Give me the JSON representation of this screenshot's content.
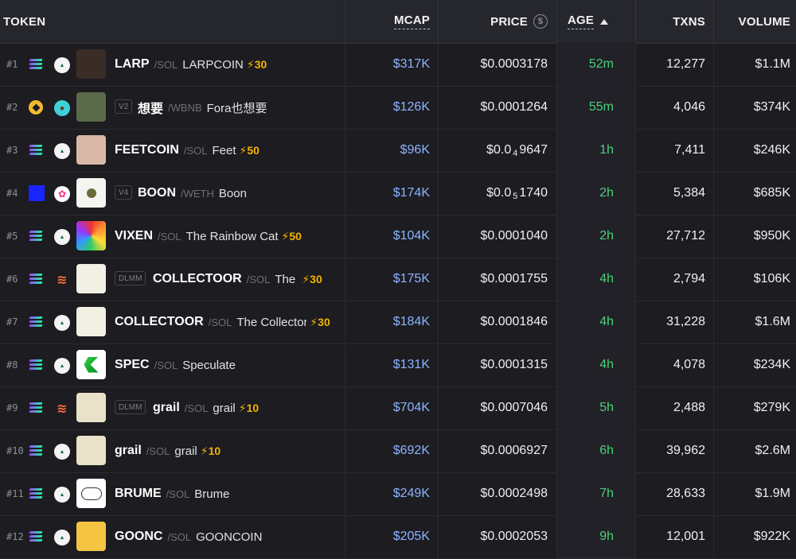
{
  "header": {
    "token": "TOKEN",
    "mcap": "MCAP",
    "price": "PRICE",
    "age": "AGE",
    "txns": "TXNS",
    "volume": "VOLUME"
  },
  "colors": {
    "mcap": "#8cb4ff",
    "age": "#4ad07a",
    "boost": "#f5b400"
  },
  "rows": [
    {
      "rank": "#1",
      "chain": "solana-icon",
      "dex": "raydium-swap-icon",
      "tag": "",
      "symbol": "LARP",
      "quote": "/SOL",
      "name": "LARPCOIN",
      "boost": "⚡30",
      "mcap": "$317K",
      "price_a": "$0.0003178",
      "price_sub": "",
      "price_b": "",
      "age": "52m",
      "txns": "12,277",
      "volume": "$1.1M"
    },
    {
      "rank": "#2",
      "chain": "bnb-icon",
      "dex": "pancakeswap-icon",
      "tag": "V2",
      "symbol": "想要",
      "quote": "/WBNB",
      "name": "Fora也想要",
      "boost": "",
      "mcap": "$126K",
      "price_a": "$0.0001264",
      "price_sub": "",
      "price_b": "",
      "age": "55m",
      "txns": "4,046",
      "volume": "$374K"
    },
    {
      "rank": "#3",
      "chain": "solana-icon",
      "dex": "raydium-swap-icon",
      "tag": "",
      "symbol": "FEETCOIN",
      "quote": "/SOL",
      "name": "Feet",
      "boost": "⚡50",
      "mcap": "$96K",
      "price_a": "$0.0",
      "price_sub": "4",
      "price_b": "9647",
      "age": "1h",
      "txns": "7,411",
      "volume": "$246K"
    },
    {
      "rank": "#4",
      "chain": "base-icon",
      "dex": "uniswap-icon",
      "tag": "V4",
      "symbol": "BOON",
      "quote": "/WETH",
      "name": "Boon",
      "boost": "",
      "mcap": "$174K",
      "price_a": "$0.0",
      "price_sub": "5",
      "price_b": "1740",
      "age": "2h",
      "txns": "5,384",
      "volume": "$685K"
    },
    {
      "rank": "#5",
      "chain": "solana-icon",
      "dex": "raydium-swap-icon",
      "tag": "",
      "symbol": "VIXEN",
      "quote": "/SOL",
      "name": "The Rainbow Cat",
      "boost": "⚡50",
      "mcap": "$104K",
      "price_a": "$0.0001040",
      "price_sub": "",
      "price_b": "",
      "age": "2h",
      "txns": "27,712",
      "volume": "$950K"
    },
    {
      "rank": "#6",
      "chain": "solana-icon",
      "dex": "meteora-icon",
      "tag": "DLMM",
      "symbol": "COLLECTOOR",
      "quote": "/SOL",
      "name": "The Collector",
      "boost": "⚡30",
      "mcap": "$175K",
      "price_a": "$0.0001755",
      "price_sub": "",
      "price_b": "",
      "age": "4h",
      "txns": "2,794",
      "volume": "$106K"
    },
    {
      "rank": "#7",
      "chain": "solana-icon",
      "dex": "raydium-swap-icon",
      "tag": "",
      "symbol": "COLLECTOOR",
      "quote": "/SOL",
      "name": "The Collector",
      "boost": "⚡30",
      "mcap": "$184K",
      "price_a": "$0.0001846",
      "price_sub": "",
      "price_b": "",
      "age": "4h",
      "txns": "31,228",
      "volume": "$1.6M"
    },
    {
      "rank": "#8",
      "chain": "solana-icon",
      "dex": "raydium-swap-icon",
      "tag": "",
      "symbol": "SPEC",
      "quote": "/SOL",
      "name": "Speculate",
      "boost": "",
      "mcap": "$131K",
      "price_a": "$0.0001315",
      "price_sub": "",
      "price_b": "",
      "age": "4h",
      "txns": "4,078",
      "volume": "$234K"
    },
    {
      "rank": "#9",
      "chain": "solana-icon",
      "dex": "meteora-icon",
      "tag": "DLMM",
      "symbol": "grail",
      "quote": "/SOL",
      "name": "grail",
      "boost": "⚡10",
      "mcap": "$704K",
      "price_a": "$0.0007046",
      "price_sub": "",
      "price_b": "",
      "age": "5h",
      "txns": "2,488",
      "volume": "$279K"
    },
    {
      "rank": "#10",
      "chain": "solana-icon",
      "dex": "raydium-swap-icon",
      "tag": "",
      "symbol": "grail",
      "quote": "/SOL",
      "name": "grail",
      "boost": "⚡10",
      "mcap": "$692K",
      "price_a": "$0.0006927",
      "price_sub": "",
      "price_b": "",
      "age": "6h",
      "txns": "39,962",
      "volume": "$2.6M"
    },
    {
      "rank": "#11",
      "chain": "solana-icon",
      "dex": "raydium-swap-icon",
      "tag": "",
      "symbol": "BRUME",
      "quote": "/SOL",
      "name": "Brume",
      "boost": "",
      "mcap": "$249K",
      "price_a": "$0.0002498",
      "price_sub": "",
      "price_b": "",
      "age": "7h",
      "txns": "28,633",
      "volume": "$1.9M"
    },
    {
      "rank": "#12",
      "chain": "solana-icon",
      "dex": "raydium-swap-icon",
      "tag": "",
      "symbol": "GOONC",
      "quote": "/SOL",
      "name": "GOONCOIN",
      "boost": "",
      "mcap": "$205K",
      "price_a": "$0.0002053",
      "price_sub": "",
      "price_b": "",
      "age": "9h",
      "txns": "12,001",
      "volume": "$922K"
    }
  ]
}
